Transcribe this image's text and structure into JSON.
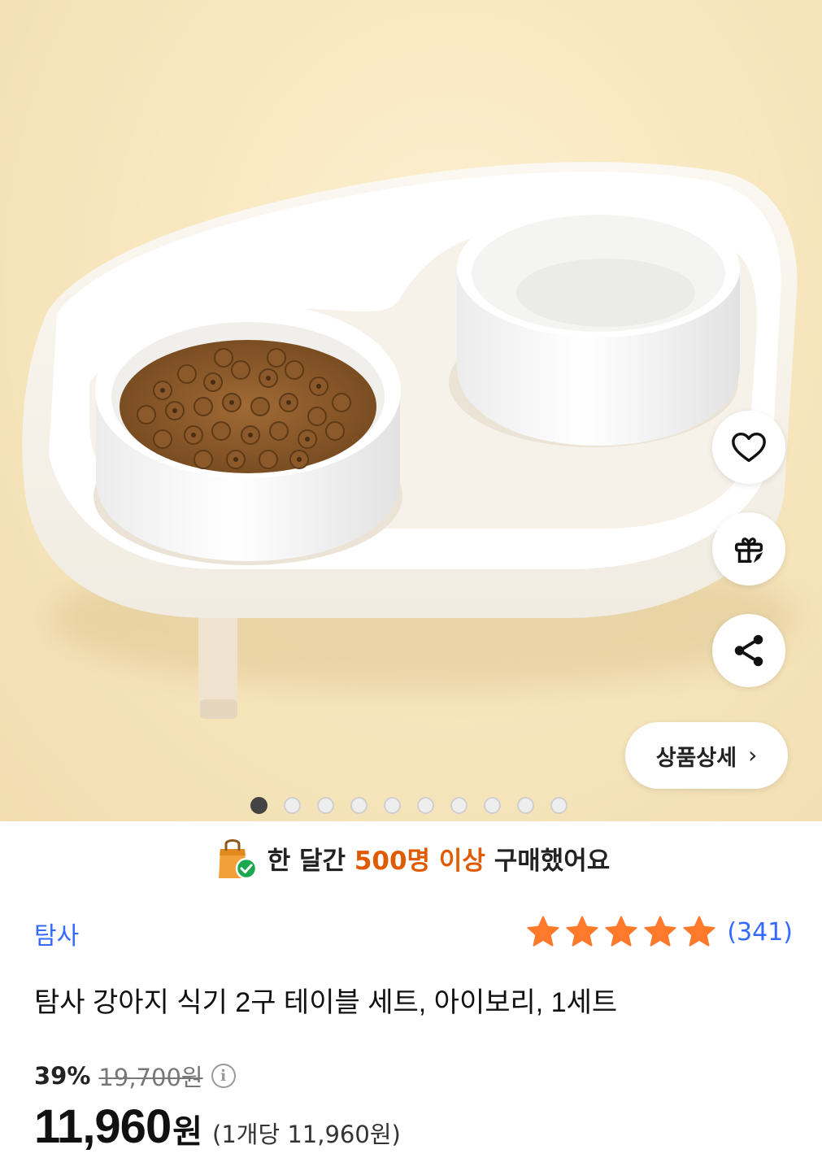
{
  "side_actions": {
    "like_icon": "heart-icon",
    "gift_icon": "gift-icon",
    "share_icon": "share-icon"
  },
  "detail_button": {
    "label": "상품상세",
    "chevron": "›"
  },
  "carousel": {
    "total": 10,
    "active_index": 0
  },
  "purchase_banner": {
    "prefix": "한 달간 ",
    "highlight": "500명 이상",
    "suffix": " 구매했어요",
    "highlight_color": "#e05a00"
  },
  "seller": {
    "name": "탐사"
  },
  "rating": {
    "stars": 5,
    "count": "(341)",
    "star_color": "#ff7a2b"
  },
  "product": {
    "title": "탐사 강아지 식기 2구 테이블 세트, 아이보리, 1세트"
  },
  "price": {
    "discount": "39%",
    "original": "19,700원",
    "current": "11,960",
    "currency": "원",
    "unit_price": "(1개당 11,960원)"
  },
  "colors": {
    "accent_blue": "#346aff"
  }
}
